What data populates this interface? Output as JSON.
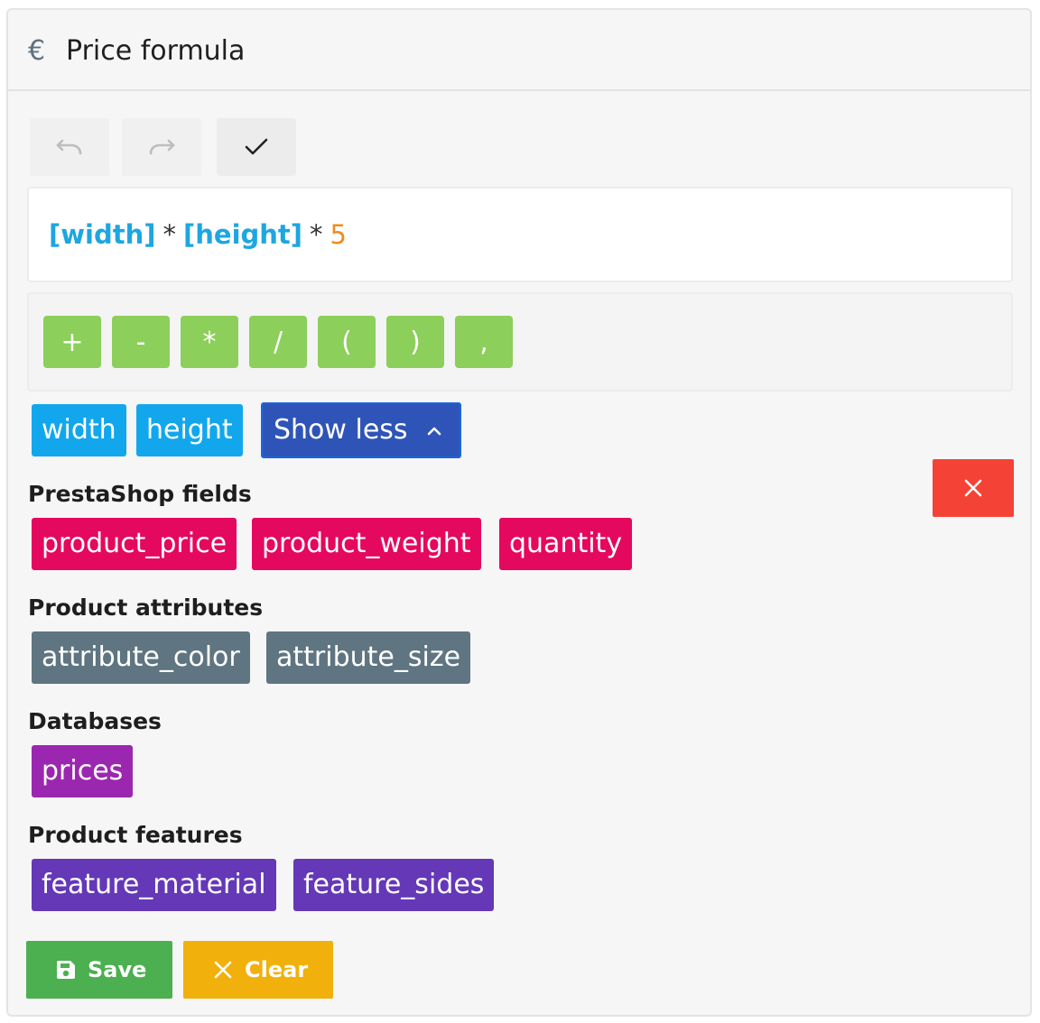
{
  "panel": {
    "title": "Price formula",
    "title_icon": "euro-icon"
  },
  "toolbar": {
    "undo_icon": "undo-icon",
    "redo_icon": "redo-icon",
    "validate_icon": "check-icon"
  },
  "formula": {
    "tokens": [
      "[width]",
      "*",
      "[height]",
      "*",
      "5"
    ]
  },
  "operators": [
    "+",
    "-",
    "*",
    "/",
    "(",
    ")",
    ","
  ],
  "variables": {
    "items": [
      "width",
      "height"
    ],
    "show_less_label": "Show less",
    "show_less_icon": "chevron-up-icon"
  },
  "sections": [
    {
      "label": "PrestaShop fields",
      "items": [
        "product_price",
        "product_weight",
        "quantity"
      ],
      "color": "#e5085f"
    },
    {
      "label": "Product attributes",
      "items": [
        "attribute_color",
        "attribute_size"
      ],
      "color": "#5f7581"
    },
    {
      "label": "Databases",
      "items": [
        "prices"
      ],
      "color": "#9b27b0"
    },
    {
      "label": "Product features",
      "items": [
        "feature_material",
        "feature_sides"
      ],
      "color": "#6438b7"
    }
  ],
  "close_button": {
    "icon": "close-icon",
    "color": "#f44336"
  },
  "actions": {
    "save_label": "Save",
    "save_icon": "floppy-disk-icon",
    "clear_label": "Clear",
    "clear_icon": "close-icon"
  },
  "colors": {
    "variable": "#1da6e0",
    "number": "#f08c1b",
    "operator_button": "#8ccf5a",
    "variable_tag": "#12a7ec",
    "show_less": "#2f54b8",
    "save": "#4caf50",
    "clear": "#f2b00c"
  }
}
